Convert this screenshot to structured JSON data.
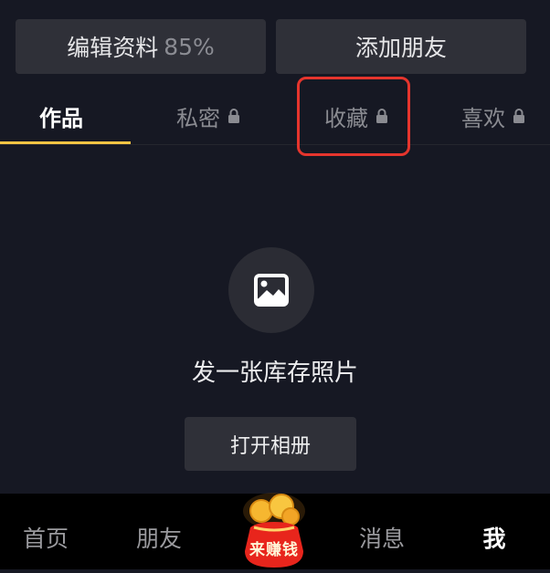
{
  "profile_actions": {
    "edit_label": "编辑资料",
    "edit_percent": "85%",
    "add_friend_label": "添加朋友"
  },
  "tabs": [
    {
      "label": "作品",
      "active": true,
      "locked": false
    },
    {
      "label": "私密",
      "active": false,
      "locked": true
    },
    {
      "label": "收藏",
      "active": false,
      "locked": true
    },
    {
      "label": "喜欢",
      "active": false,
      "locked": true
    }
  ],
  "empty_state": {
    "icon": "image-icon",
    "text": "发一张库存照片",
    "button_label": "打开相册"
  },
  "bottom_nav": {
    "home": "首页",
    "friends": "朋友",
    "earn": "来赚钱",
    "messages": "消息",
    "me": "我"
  },
  "colors": {
    "background": "#161823",
    "active_tab_underline": "#f5c443",
    "highlight_box": "#e6352d",
    "button_bg": "#2f3038"
  }
}
